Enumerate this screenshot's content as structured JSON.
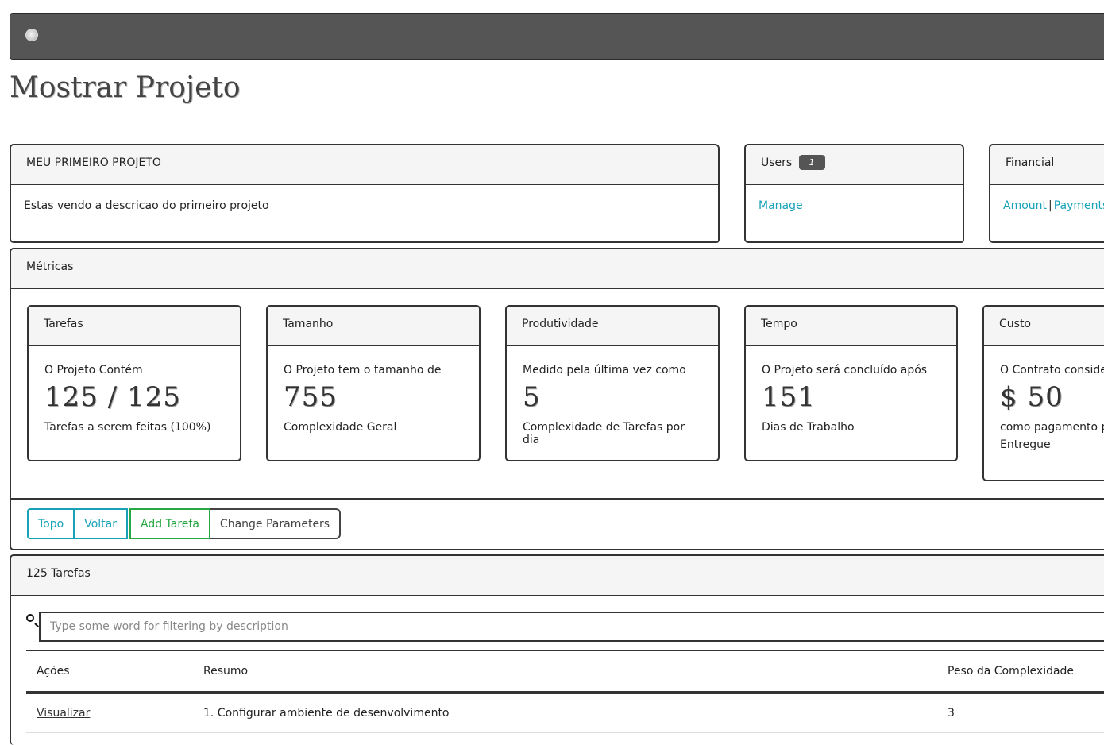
{
  "page": {
    "title": "Mostrar Projeto"
  },
  "project": {
    "name": "MEU PRIMEIRO PROJETO",
    "description": "Estas vendo a descricao do primeiro projeto"
  },
  "users": {
    "title": "Users",
    "count": "1",
    "manage_link": "Manage"
  },
  "financial": {
    "title": "Financial",
    "amount_link": "Amount",
    "payments_link": "Payments",
    "separator": "|"
  },
  "metrics": {
    "title": "Métricas",
    "cards": [
      {
        "title": "Tarefas",
        "line1": "O Projeto Contém",
        "big": "125 / 125",
        "line2": "Tarefas a serem feitas (100%)"
      },
      {
        "title": "Tamanho",
        "line1": "O Projeto tem o tamanho de",
        "big": "755",
        "line2": "Complexidade Geral"
      },
      {
        "title": "Produtividade",
        "line1": "Medido pela última vez como",
        "big": "5",
        "line2": "Complexidade de Tarefas por dia"
      },
      {
        "title": "Tempo",
        "line1": "O Projeto será concluído após",
        "big": "151",
        "line2": "Dias de Trabalho"
      },
      {
        "title": "Custo",
        "line1": "O Contrato considera",
        "big": "$ 50",
        "line2": "como pagamento pela",
        "line3": "Entregue"
      }
    ],
    "buttons": {
      "top": "Topo",
      "back": "Voltar",
      "add_task": "Add Tarefa",
      "change_params": "Change Parameters"
    }
  },
  "tasks": {
    "title": "125 Tarefas",
    "search_placeholder": "Type some word for filtering by description",
    "columns": [
      "Ações",
      "Resumo",
      "Peso da Complexidade"
    ],
    "rows": [
      {
        "action": "Visualizar",
        "summary": "1. Configurar ambiente de desenvolvimento",
        "weight": "3"
      }
    ]
  },
  "colors": {
    "topbar": "#555555",
    "info": "#17a2b8",
    "success": "#28a745",
    "badge": "#555555"
  }
}
